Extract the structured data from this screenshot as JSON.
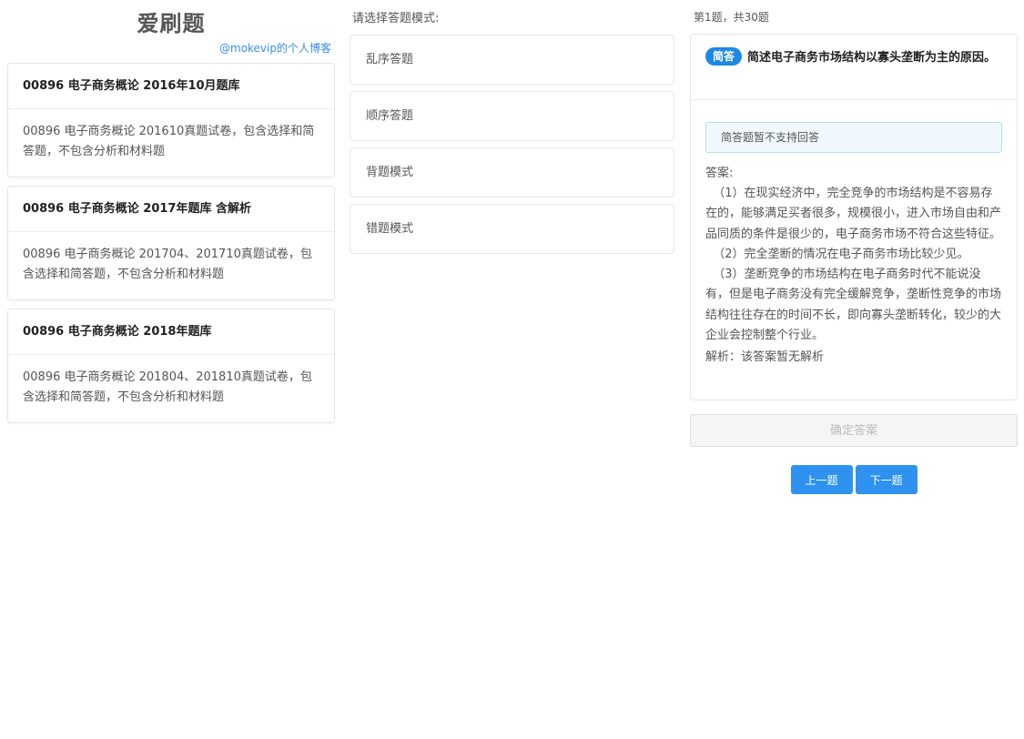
{
  "brand": {
    "title": "爱刷题",
    "subtitle": "@mokevip的个人博客"
  },
  "banks": [
    {
      "title": "00896 电子商务概论 2016年10月题库",
      "desc": "00896 电子商务概论 201610真题试卷，包含选择和简答题，不包含分析和材料题"
    },
    {
      "title": "00896 电子商务概论 2017年题库 含解析",
      "desc": "00896 电子商务概论 201704、201710真题试卷，包含选择和简答题，不包含分析和材料题"
    },
    {
      "title": "00896 电子商务概论 2018年题库",
      "desc": "00896 电子商务概论 201804、201810真题试卷，包含选择和简答题，不包含分析和材料题"
    }
  ],
  "modes": {
    "prompt": "请选择答题模式:",
    "items": [
      "乱序答题",
      "顺序答题",
      "背题模式",
      "错题模式"
    ]
  },
  "question": {
    "progress": "第1题，共30题",
    "type_tag": "简答",
    "stem": "简述电子商务市场结构以寡头垄断为主的原因。",
    "notice": "简答题暂不支持回答",
    "answer_label": "答案:",
    "answer_text": "  （1）在现实经济中，完全竞争的市场结构是不容易存在的，能够满足买者很多，规模很小，进入市场自由和产品同质的条件是很少的，电子商务市场不符合这些特征。\n  （2）完全垄断的情况在电子商务市场比较少见。\n  （3）垄断竞争的市场结构在电子商务时代不能说没有，但是电子商务没有完全缓解竞争，垄断性竞争的市场结构往往存在的时间不长，即向寡头垄断转化，较少的大企业会控制整个行业。",
    "analysis": "解析：该答案暂无解析"
  },
  "actions": {
    "confirm": "确定答案",
    "prev": "上一题",
    "next": "下一题"
  },
  "colors": {
    "accent": "#2f92f0",
    "tag": "#1e88e5",
    "link": "#3a8ee6",
    "notice_bg": "#f0f8fd",
    "notice_border": "#b3dcf5"
  }
}
